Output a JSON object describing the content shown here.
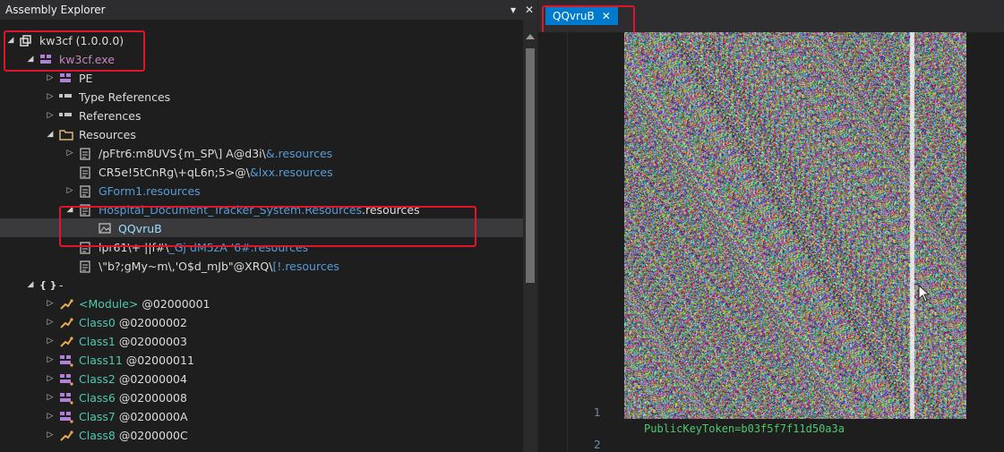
{
  "panel": {
    "title": "Assembly Explorer",
    "dropdown_glyph": "▾",
    "close_glyph": "✕"
  },
  "tree": [
    {
      "level": 0,
      "expand": "expanded",
      "icon": "assembly-icon",
      "label": "kw3cf (1.0.0.0)",
      "color": "white"
    },
    {
      "level": 1,
      "expand": "expanded",
      "icon": "module-icon",
      "label": "kw3cf.exe",
      "color": "purple"
    },
    {
      "level": 2,
      "expand": "collapsed",
      "icon": "module-icon",
      "label": "PE",
      "color": "white"
    },
    {
      "level": 2,
      "expand": "collapsed",
      "icon": "references-icon",
      "label": "Type References",
      "color": "white"
    },
    {
      "level": 2,
      "expand": "collapsed",
      "icon": "references-icon",
      "label": "References",
      "color": "white"
    },
    {
      "level": 2,
      "expand": "expanded",
      "icon": "folder-icon",
      "label": "Resources",
      "color": "white"
    },
    {
      "level": 3,
      "expand": "collapsed",
      "icon": "resource-file-icon",
      "label": "/pFtr6:m8UVS{m_SP\\] A@d3i\\",
      "label2": "&.resources",
      "color": "white",
      "color2": "blue"
    },
    {
      "level": 3,
      "expand": "none",
      "icon": "resource-file-icon",
      "label": "CR5e!5tCnRg\\+qL6n;5>@\\",
      "label2": "&lxx.resources",
      "color": "white",
      "color2": "blue"
    },
    {
      "level": 3,
      "expand": "collapsed",
      "icon": "resource-file-icon",
      "label": "GForm1.resources",
      "color": "blue"
    },
    {
      "level": 3,
      "expand": "expanded",
      "icon": "resource-file-icon",
      "label": "Hospital_Document_Tracker_System.Resources",
      "label2": ".resources",
      "color": "blue",
      "color2": "white"
    },
    {
      "level": 4,
      "expand": "none",
      "icon": "image-icon",
      "label": "QQvruB",
      "color": "ltblue",
      "selected": true
    },
    {
      "level": 3,
      "expand": "none",
      "icon": "resource-file-icon",
      "label": "lpr61\\+ ||f#\\",
      "label2": "_Gj dM5zA '6#.resources",
      "color": "white",
      "color2": "blue"
    },
    {
      "level": 3,
      "expand": "none",
      "icon": "resource-file-icon",
      "label": "\\\"b?;gMy~m\\,'O$d_mJb\"@XRQ\\",
      "label2": "[!.resources",
      "color": "white",
      "color2": "blue"
    },
    {
      "level": 1,
      "expand": "expanded",
      "icon": "namespace-icon",
      "label": "-",
      "color": "white"
    },
    {
      "level": 2,
      "expand": "collapsed",
      "icon": "class-icon",
      "label": "<Module>",
      "label2": " @02000001",
      "color": "green",
      "color2": "white"
    },
    {
      "level": 2,
      "expand": "collapsed",
      "icon": "class-icon",
      "label": "Class0",
      "label2": " @02000002",
      "color": "green",
      "color2": "white"
    },
    {
      "level": 2,
      "expand": "collapsed",
      "icon": "class-icon",
      "label": "Class1",
      "label2": " @02000003",
      "color": "green",
      "color2": "white"
    },
    {
      "level": 2,
      "expand": "collapsed",
      "icon": "class-icon-purple",
      "label": "Class11",
      "label2": " @02000011",
      "color": "green",
      "color2": "white"
    },
    {
      "level": 2,
      "expand": "collapsed",
      "icon": "class-icon-purple",
      "label": "Class2",
      "label2": " @02000004",
      "color": "green",
      "color2": "white"
    },
    {
      "level": 2,
      "expand": "collapsed",
      "icon": "class-icon-purple",
      "label": "Class6",
      "label2": " @02000008",
      "color": "green",
      "color2": "white"
    },
    {
      "level": 2,
      "expand": "collapsed",
      "icon": "class-icon-purple",
      "label": "Class7",
      "label2": " @0200000A",
      "color": "green",
      "color2": "white"
    },
    {
      "level": 2,
      "expand": "collapsed",
      "icon": "class-icon",
      "label": "Class8",
      "label2": " @0200000C",
      "color": "green",
      "color2": "white"
    }
  ],
  "editor": {
    "tab_label": "QQvruB",
    "tab_close": "✕",
    "line_numbers": [
      "1",
      "2"
    ],
    "code_line": "PublicKeyToken=b03f5f7f11d50a3a"
  },
  "colors": {
    "accent": "#007acc",
    "highlight": "#e0142a",
    "background": "#1e1e1e"
  }
}
